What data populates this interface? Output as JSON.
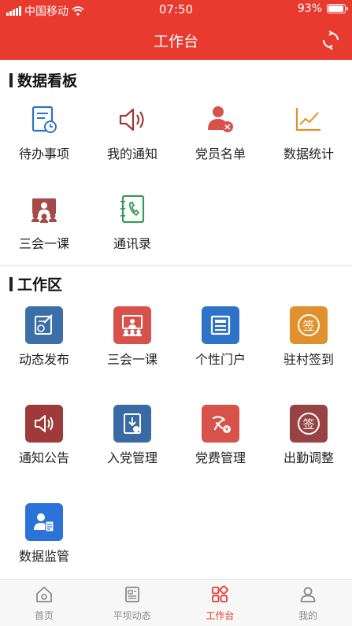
{
  "status_bar": {
    "carrier": "中国移动",
    "time": "07:50",
    "battery": "93%",
    "battery_level": 0.93
  },
  "header": {
    "title": "工作台"
  },
  "dashboard": {
    "title": "数据看板",
    "items": [
      {
        "label": "待办事项",
        "icon": "todo-icon"
      },
      {
        "label": "我的通知",
        "icon": "speaker-icon"
      },
      {
        "label": "党员名单",
        "icon": "party-member-icon"
      },
      {
        "label": "数据统计",
        "icon": "line-chart-icon"
      },
      {
        "label": "三会一课",
        "icon": "meeting-icon"
      },
      {
        "label": "通讯录",
        "icon": "contacts-book-icon"
      }
    ]
  },
  "workspace": {
    "title": "工作区",
    "items": [
      {
        "label": "动态发布",
        "icon": "publish-icon",
        "color": "#3c6ea8"
      },
      {
        "label": "三会一课",
        "icon": "meeting-icon",
        "color": "#d6524a"
      },
      {
        "label": "个性门户",
        "icon": "portal-icon",
        "color": "#2c73c9"
      },
      {
        "label": "驻村签到",
        "icon": "sign-in-icon",
        "color": "#e0902c"
      },
      {
        "label": "通知公告",
        "icon": "speaker-icon",
        "color": "#9e3a3a"
      },
      {
        "label": "入党管理",
        "icon": "join-party-icon",
        "color": "#3a6aa4"
      },
      {
        "label": "党费管理",
        "icon": "party-fee-icon",
        "color": "#d6524a"
      },
      {
        "label": "出勤调整",
        "icon": "attendance-icon",
        "color": "#974343"
      },
      {
        "label": "数据监管",
        "icon": "data-supervision-icon",
        "color": "#2c73d9"
      }
    ]
  },
  "tab_bar": {
    "items": [
      {
        "label": "首页",
        "icon": "home-icon"
      },
      {
        "label": "平坝动态",
        "icon": "news-icon"
      },
      {
        "label": "工作台",
        "icon": "workbench-icon",
        "active": true
      },
      {
        "label": "我的",
        "icon": "user-icon"
      }
    ]
  }
}
